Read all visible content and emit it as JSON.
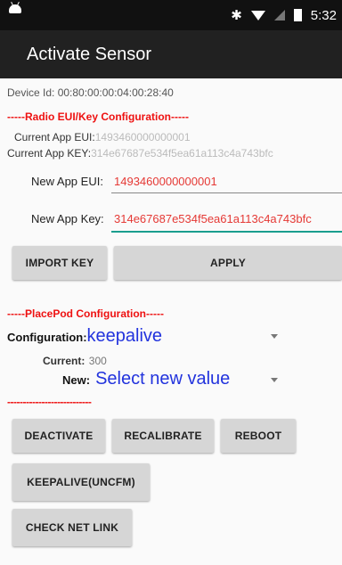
{
  "status_bar": {
    "icons": [
      "android-icon",
      "bluetooth-icon",
      "wifi-icon",
      "signal-icon",
      "battery-icon"
    ],
    "bluetooth_glyph": "✱",
    "time": "5:32"
  },
  "app_bar": {
    "title": "Activate Sensor"
  },
  "device": {
    "label": "Device Id: 00:80:00:00:04:00:28:40"
  },
  "radio": {
    "header": "-----Radio EUI/Key Configuration-----",
    "current_eui_label": "Current App EUI:",
    "current_eui_value": "1493460000000001",
    "current_key_label": "Current App KEY:",
    "current_key_value": "314e67687e534f5ea61a113c4a743bfc",
    "new_eui_label": "New App EUI:",
    "new_eui_value": "1493460000000001",
    "new_key_label": "New App Key:",
    "new_key_value": "314e67687e534f5ea61a113c4a743bfc"
  },
  "buttons": {
    "import_key": "IMPORT KEY",
    "apply": "APPLY",
    "deactivate": "DEACTIVATE",
    "recalibrate": "RECALIBRATE",
    "reboot": "REBOOT",
    "keepalive": "KEEPALIVE(UNCFM)",
    "check_net_link": "CHECK NET LINK"
  },
  "placepod": {
    "header": "-----PlacePod Configuration-----",
    "config_label": "Configuration:",
    "config_value": "keepalive",
    "current_label": "Current:",
    "current_value": "300",
    "new_label": "New:",
    "new_value": "Select new value",
    "separator": "---------------------------"
  },
  "colors": {
    "accent_red": "#ee1111",
    "spinner_blue": "#2233dd",
    "app_bar": "#212121"
  }
}
